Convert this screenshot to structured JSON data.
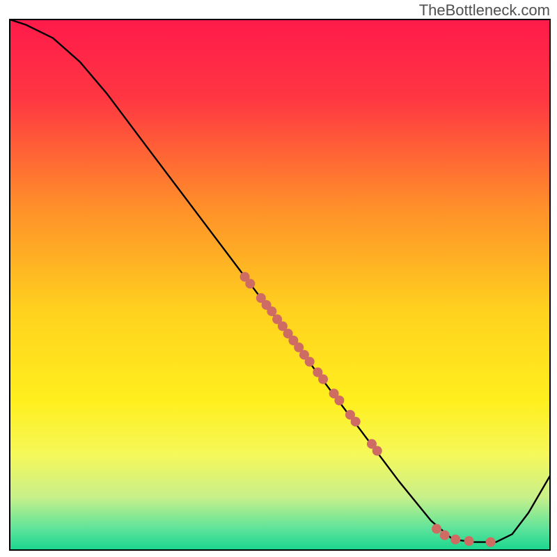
{
  "watermark": "TheBottleneck.com",
  "chart_data": {
    "type": "line",
    "title": "",
    "xlabel": "",
    "ylabel": "",
    "xlim": [
      0,
      100
    ],
    "ylim": [
      0,
      100
    ],
    "background_gradient": {
      "stops": [
        {
          "offset": 0.0,
          "color": "#ff1a4a"
        },
        {
          "offset": 0.15,
          "color": "#ff3742"
        },
        {
          "offset": 0.35,
          "color": "#ff8e2a"
        },
        {
          "offset": 0.55,
          "color": "#ffd21e"
        },
        {
          "offset": 0.72,
          "color": "#ffef1e"
        },
        {
          "offset": 0.82,
          "color": "#f6f85a"
        },
        {
          "offset": 0.9,
          "color": "#c8f08a"
        },
        {
          "offset": 0.96,
          "color": "#5de39a"
        },
        {
          "offset": 1.0,
          "color": "#1ad68f"
        }
      ]
    },
    "curve": [
      {
        "x": 0,
        "y": 100
      },
      {
        "x": 3,
        "y": 99
      },
      {
        "x": 8,
        "y": 96.5
      },
      {
        "x": 13,
        "y": 92
      },
      {
        "x": 18,
        "y": 86
      },
      {
        "x": 25,
        "y": 76.5
      },
      {
        "x": 35,
        "y": 63
      },
      {
        "x": 45,
        "y": 49.5
      },
      {
        "x": 55,
        "y": 36
      },
      {
        "x": 65,
        "y": 22.5
      },
      {
        "x": 72,
        "y": 13
      },
      {
        "x": 78,
        "y": 5.5
      },
      {
        "x": 82,
        "y": 2
      },
      {
        "x": 86,
        "y": 1.5
      },
      {
        "x": 90,
        "y": 1.5
      },
      {
        "x": 93,
        "y": 3
      },
      {
        "x": 96,
        "y": 7
      },
      {
        "x": 100,
        "y": 14
      }
    ],
    "markers": [
      {
        "x": 43.5,
        "y": 51.5
      },
      {
        "x": 44.5,
        "y": 50.2
      },
      {
        "x": 46.5,
        "y": 47.5
      },
      {
        "x": 47.5,
        "y": 46.2
      },
      {
        "x": 48.5,
        "y": 45.0
      },
      {
        "x": 49.5,
        "y": 43.5
      },
      {
        "x": 50.5,
        "y": 42.2
      },
      {
        "x": 51.5,
        "y": 40.8
      },
      {
        "x": 52.5,
        "y": 39.5
      },
      {
        "x": 53.5,
        "y": 38.2
      },
      {
        "x": 54.5,
        "y": 36.8
      },
      {
        "x": 55.5,
        "y": 35.5
      },
      {
        "x": 57.0,
        "y": 33.5
      },
      {
        "x": 58.0,
        "y": 32.2
      },
      {
        "x": 60.0,
        "y": 29.5
      },
      {
        "x": 61.0,
        "y": 28.2
      },
      {
        "x": 63.0,
        "y": 25.5
      },
      {
        "x": 64.0,
        "y": 24.2
      },
      {
        "x": 67.0,
        "y": 20.0
      },
      {
        "x": 68.0,
        "y": 18.7
      },
      {
        "x": 79.0,
        "y": 4.0
      },
      {
        "x": 80.5,
        "y": 2.8
      },
      {
        "x": 82.5,
        "y": 2.0
      },
      {
        "x": 85.0,
        "y": 1.7
      },
      {
        "x": 89.0,
        "y": 1.5
      }
    ],
    "marker_color": "#ce6b62",
    "marker_radius": 7,
    "frame_color": "#000000",
    "frame_width": 2,
    "line_color": "#000000",
    "line_width": 2.4
  }
}
